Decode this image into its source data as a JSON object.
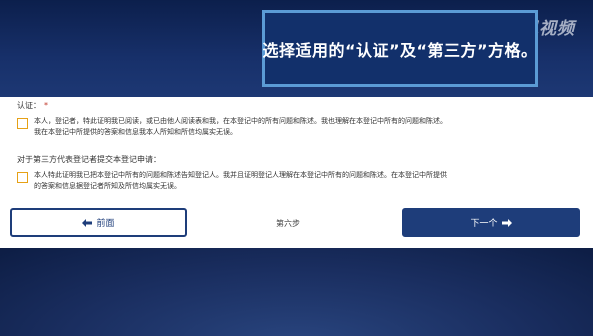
{
  "caption": {
    "text": "选择适用的“认证”及“第三方”方格。"
  },
  "watermark": {
    "text": "腾讯视频"
  },
  "form": {
    "certification": {
      "label": "认证：",
      "required_mark": "*",
      "checkbox_line1": "本人，登记者，特此证明我已阅读，或已由他人阅读表和我，在本登记中的所有问题和陈述。我也理解在本登记中所有的问题和陈述。",
      "checkbox_line2": "我在本登记中所提供的答案和信息我本人所知和所信均属实无误。"
    },
    "third_party": {
      "label": "对于第三方代表登记者提交本登记申请：",
      "checkbox_line1": "本人特此证明我已把本登记中所有的问题和陈述告知登记人。我并且证明登记人理解在本登记中所有的问题和陈述。在本登记中所提供",
      "checkbox_line2": "的答案和信息据登记者所知及所信均属实无误。"
    }
  },
  "nav": {
    "prev_label": "前面",
    "step_label": "第六步",
    "next_label": "下一个"
  },
  "colors": {
    "primary": "#1e3d7a",
    "checkbox_border": "#e6a116",
    "caption_border": "#5b9bd5"
  }
}
